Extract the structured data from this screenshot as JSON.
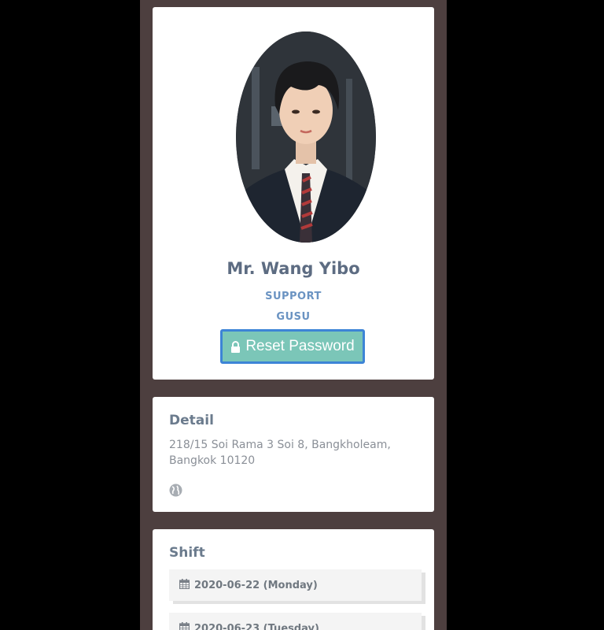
{
  "profile": {
    "name": "Mr. Wang Yibo",
    "role": "SUPPORT",
    "department": "GUSU",
    "reset_button_label": "Reset Password",
    "avatar_icon": "profile-photo"
  },
  "detail": {
    "title": "Detail",
    "address": "218/15 Soi Rama 3 Soi 8, Bangkholeam, Bangkok 10120",
    "icon": "globe-icon"
  },
  "shift": {
    "title": "Shift",
    "items": [
      {
        "date": "2020-06-22 (Monday)",
        "icon": "calendar-icon"
      },
      {
        "date": "2020-06-23 (Tuesday)",
        "icon": "calendar-icon"
      }
    ]
  },
  "colors": {
    "background": "#4d3f3f",
    "card": "#ffffff",
    "button": "#7bc6b8",
    "button_border": "#3d84d6",
    "accent_text": "#6a93c2"
  }
}
